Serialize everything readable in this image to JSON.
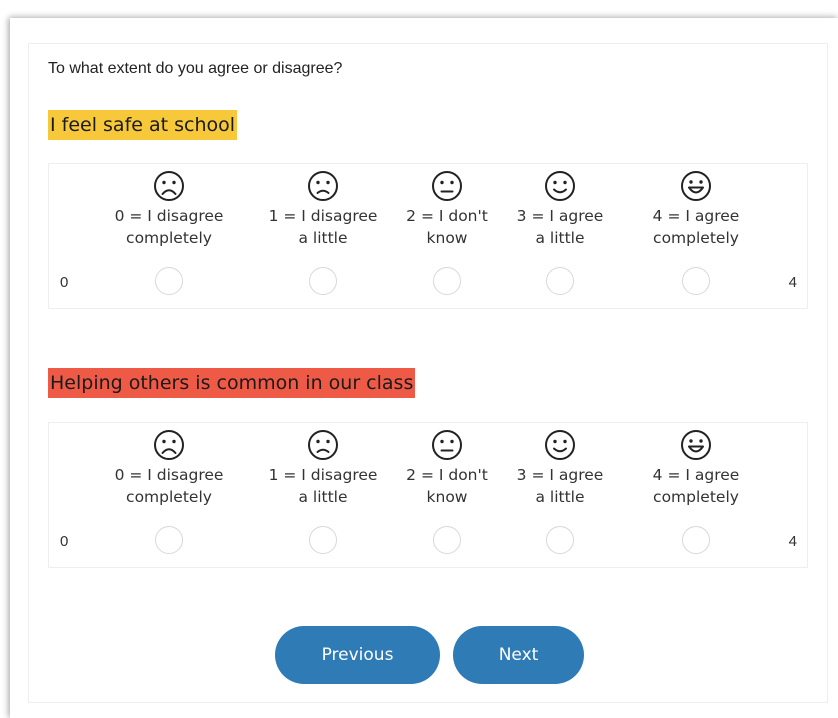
{
  "prompt": "To what extent do you agree or disagree?",
  "questions": [
    {
      "statement": "I feel safe at school",
      "highlight_color": "#f7c83a",
      "scale_min_label": "0",
      "scale_max_label": "4",
      "options": [
        {
          "line1": "0 = I disagree",
          "line2": "completely",
          "icon": "very-sad-face-icon"
        },
        {
          "line1": "1 = I disagree",
          "line2": "a little",
          "icon": "sad-face-icon"
        },
        {
          "line1": "2 = I don't",
          "line2": "know",
          "icon": "neutral-face-icon"
        },
        {
          "line1": "3 = I agree",
          "line2": "a little",
          "icon": "smile-face-icon"
        },
        {
          "line1": "4 = I agree",
          "line2": "completely",
          "icon": "big-smile-face-icon"
        }
      ]
    },
    {
      "statement": "Helping others is common in our class",
      "highlight_color": "#ef5a47",
      "scale_min_label": "0",
      "scale_max_label": "4",
      "options": [
        {
          "line1": "0 = I disagree",
          "line2": "completely",
          "icon": "very-sad-face-icon"
        },
        {
          "line1": "1 = I disagree",
          "line2": "a little",
          "icon": "sad-face-icon"
        },
        {
          "line1": "2 = I don't",
          "line2": "know",
          "icon": "neutral-face-icon"
        },
        {
          "line1": "3 = I agree",
          "line2": "a little",
          "icon": "smile-face-icon"
        },
        {
          "line1": "4 = I agree",
          "line2": "completely",
          "icon": "big-smile-face-icon"
        }
      ]
    }
  ],
  "navigation": {
    "previous_label": "Previous",
    "next_label": "Next",
    "button_color": "#2f7bb6"
  }
}
